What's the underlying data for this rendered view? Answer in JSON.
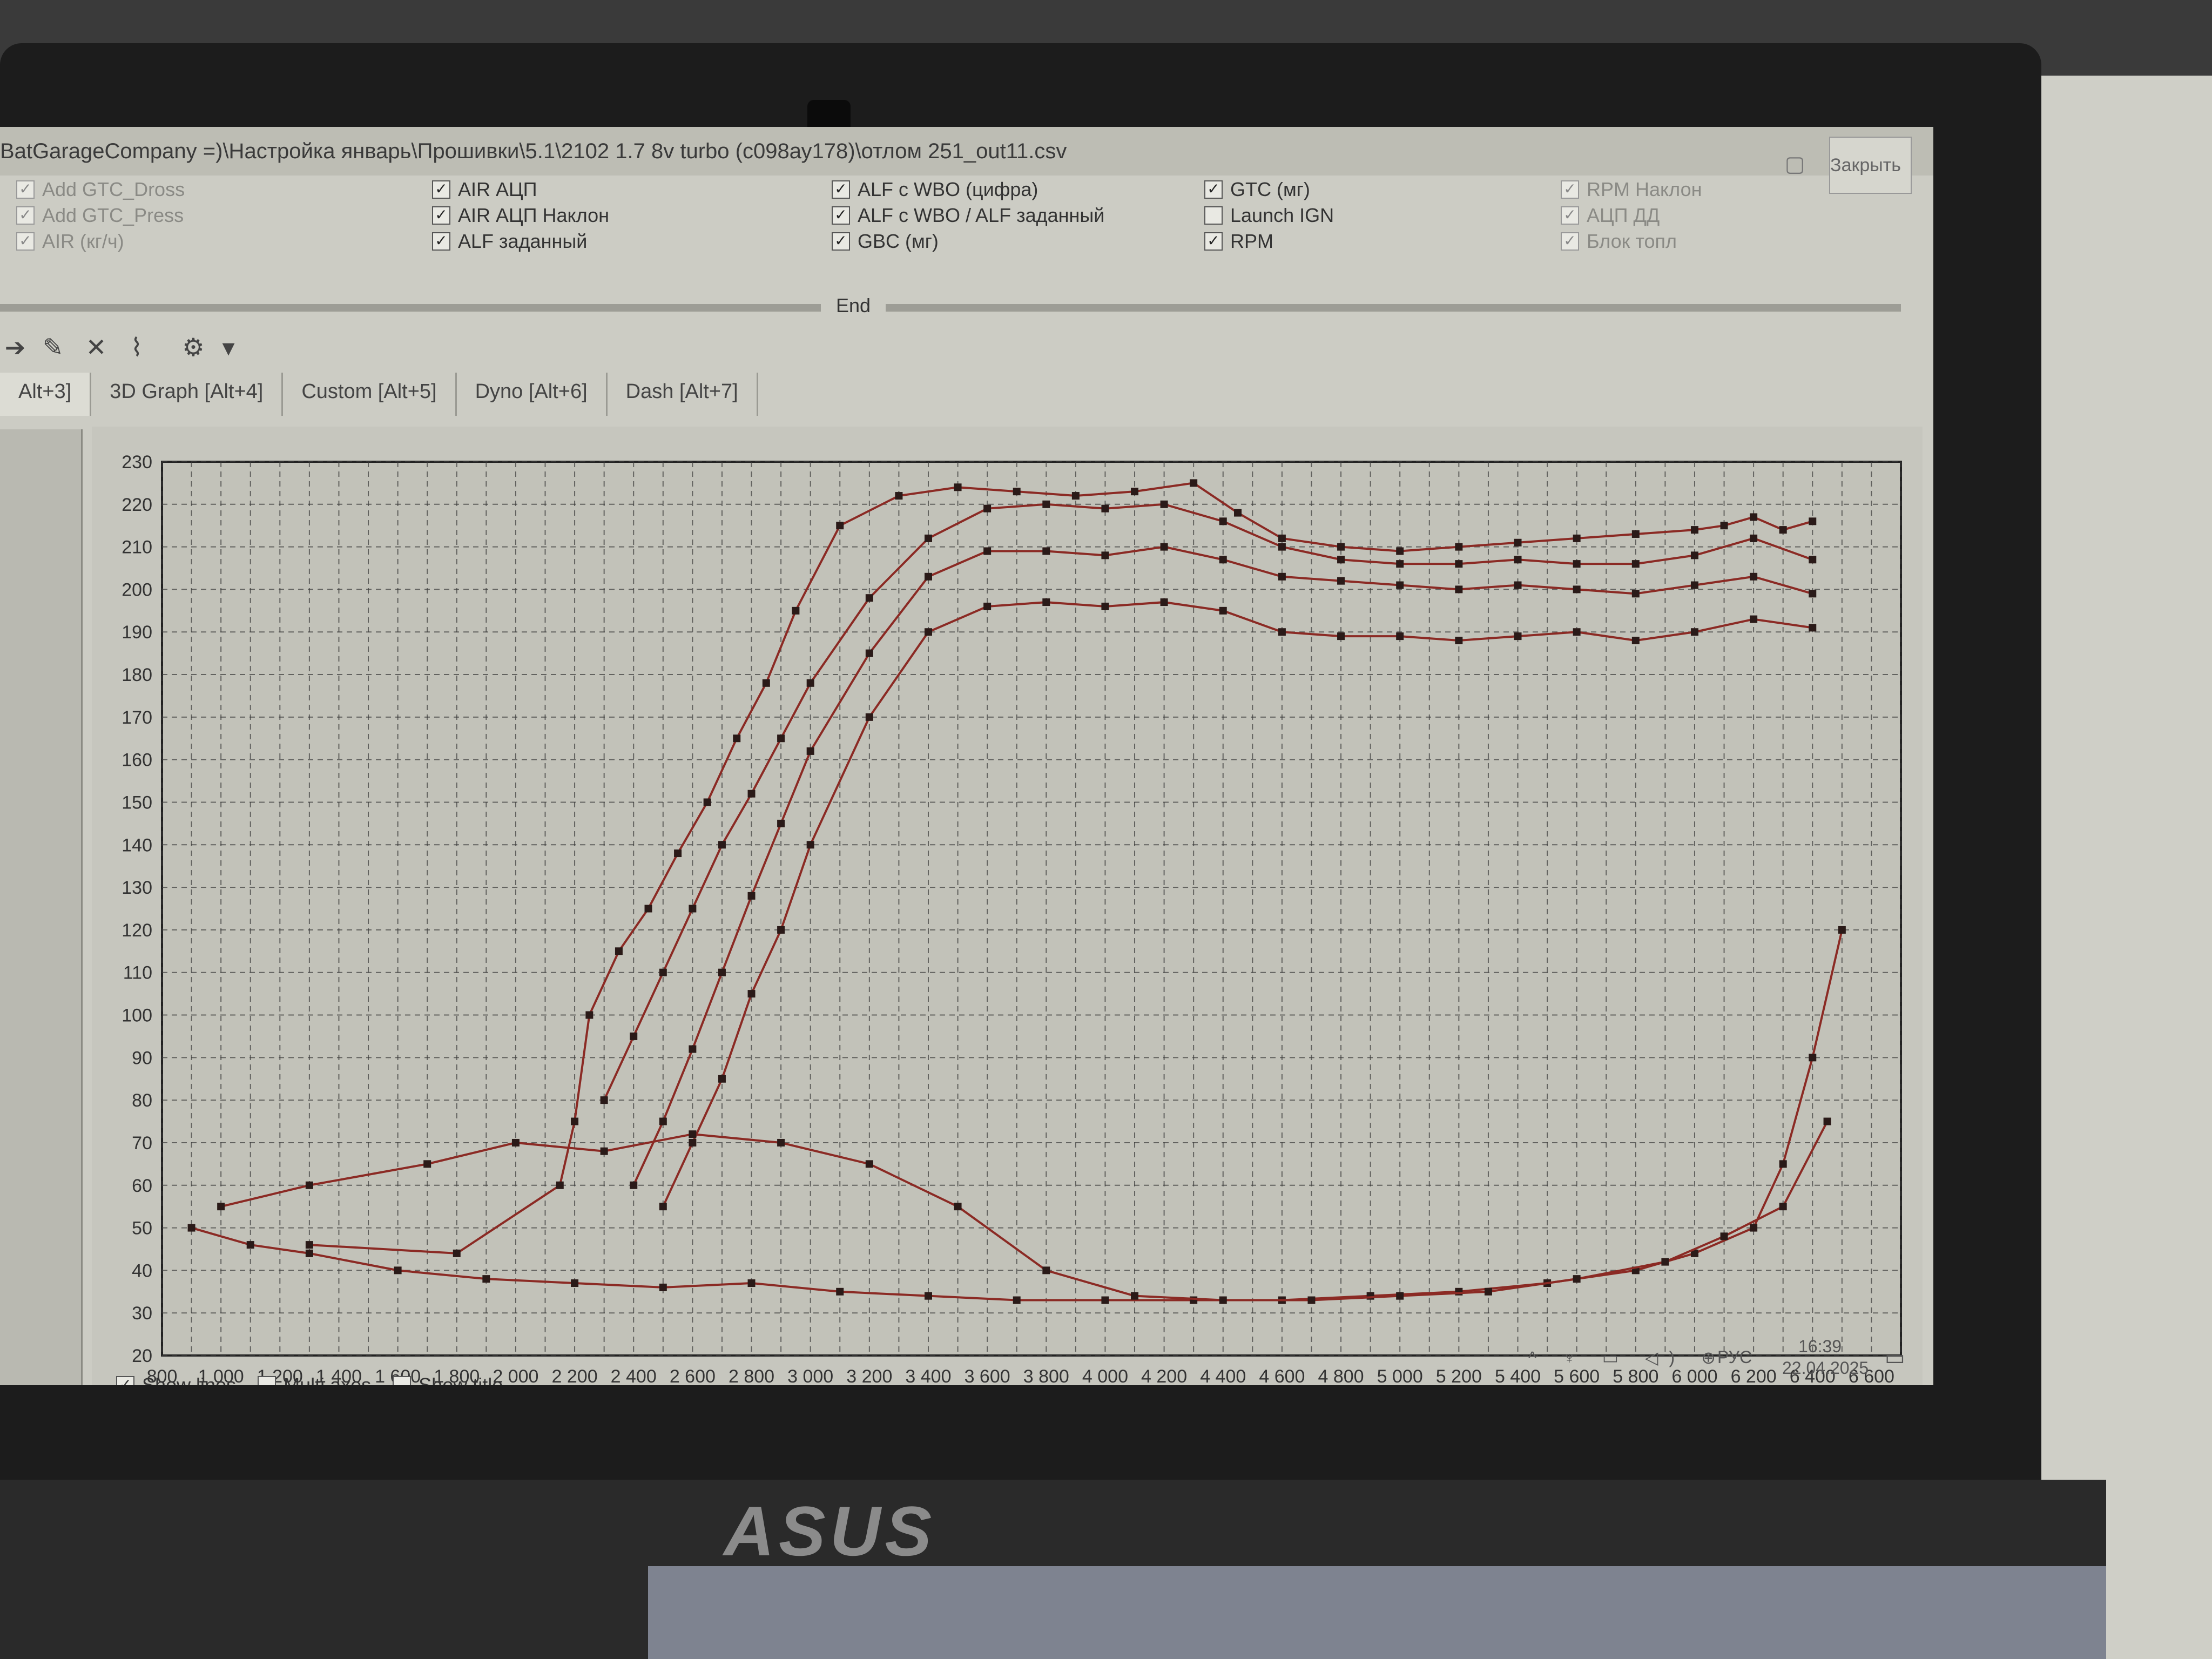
{
  "window": {
    "title": "BatGarageCompany =)\\Настройка январь\\Прошивки\\5.1\\2102 1.7 8v turbo (с098ау178)\\отлом 251_out11.csv",
    "close_label": "Закрыть"
  },
  "checkboxes": [
    {
      "label": "Add GTC_Dross",
      "checked": true,
      "faded": true
    },
    {
      "label": "Add GTC_Press",
      "checked": true,
      "faded": true
    },
    {
      "label": "AIR (кг/ч)",
      "checked": true,
      "faded": true
    },
    {
      "label": "AIR АЦП",
      "checked": true,
      "faded": false
    },
    {
      "label": "AIR АЦП Наклон",
      "checked": true,
      "faded": false
    },
    {
      "label": "ALF заданный",
      "checked": true,
      "faded": false
    },
    {
      "label": "ALF с WBO (цифра)",
      "checked": true,
      "faded": false
    },
    {
      "label": "ALF с WBO / ALF заданный",
      "checked": true,
      "faded": false
    },
    {
      "label": "GBC (мг)",
      "checked": true,
      "faded": false
    },
    {
      "label": "GTC (мг)",
      "checked": true,
      "faded": false
    },
    {
      "label": "Launch IGN",
      "checked": false,
      "faded": false
    },
    {
      "label": "RPM",
      "checked": true,
      "faded": false
    },
    {
      "label": "RPM Наклон",
      "checked": true,
      "faded": true
    },
    {
      "label": "АЦП ДД",
      "checked": true,
      "faded": true
    },
    {
      "label": "Блок топл",
      "checked": true,
      "faded": true
    }
  ],
  "range": {
    "end_label": "End"
  },
  "toolbar": {
    "icons": [
      "arrow-icon",
      "edit-chart-icon",
      "clear-icon",
      "chart-icon",
      "settings-icon",
      "dropdown-icon"
    ]
  },
  "tabs": [
    "Alt+3]",
    "3D Graph [Alt+4]",
    "Custom [Alt+5]",
    "Dyno [Alt+6]",
    "Dash [Alt+7]"
  ],
  "options": [
    {
      "label": "Show lines",
      "checked": true
    },
    {
      "label": "Multi axes",
      "checked": false
    },
    {
      "label": "Show title",
      "checked": false
    }
  ],
  "tray": {
    "icons": "^ ♆ ▭ ◁) ⊕",
    "lang": "РУС",
    "time": "16:39",
    "date": "22.04.2025",
    "notify_icon": "notification-icon"
  },
  "laptop": {
    "brand": "ASUS"
  },
  "colors": {
    "line": "#8b2a24",
    "marker": "#2a1a18",
    "grid": "#3a3a3a",
    "plot_bg": "#c2c2b9"
  },
  "chart_data": {
    "type": "scatter",
    "title": "",
    "xlabel": "",
    "ylabel": "",
    "xlim": [
      800,
      6700
    ],
    "ylim": [
      20,
      230
    ],
    "x_ticks": [
      "800",
      "1 000",
      "1 200",
      "1 400",
      "1 600",
      "1 800",
      "2 000",
      "2 200",
      "2 400",
      "2 600",
      "2 800",
      "3 000",
      "3 200",
      "3 400",
      "3 600",
      "3 800",
      "4 000",
      "4 200",
      "4 400",
      "4 600",
      "4 800",
      "5 000",
      "5 200",
      "5 400",
      "5 600",
      "5 800",
      "6 000",
      "6 200",
      "6 400",
      "6 600"
    ],
    "y_ticks": [
      "20",
      "30",
      "40",
      "50",
      "60",
      "70",
      "80",
      "90",
      "100",
      "110",
      "120",
      "130",
      "140",
      "150",
      "160",
      "170",
      "180",
      "190",
      "200",
      "210",
      "220",
      "230"
    ],
    "series": [
      {
        "x": [
          1300,
          1800,
          2150,
          2200,
          2250,
          2350,
          2450,
          2550,
          2650,
          2750,
          2850,
          2950,
          3100,
          3300,
          3500,
          3700,
          3900,
          4100,
          4300,
          4450,
          4600,
          4800,
          5000,
          5200,
          5400,
          5600,
          5800,
          6000,
          6100,
          6200,
          6300,
          6400
        ],
        "y": [
          46,
          44,
          60,
          75,
          100,
          115,
          125,
          138,
          150,
          165,
          178,
          195,
          215,
          222,
          224,
          223,
          222,
          223,
          225,
          218,
          212,
          210,
          209,
          210,
          211,
          212,
          213,
          214,
          215,
          217,
          214,
          216
        ]
      },
      {
        "x": [
          2300,
          2400,
          2500,
          2600,
          2700,
          2800,
          2900,
          3000,
          3200,
          3400,
          3600,
          3800,
          4000,
          4200,
          4400,
          4600,
          4800,
          5000,
          5200,
          5400,
          5600,
          5800,
          6000,
          6200,
          6400
        ],
        "y": [
          80,
          95,
          110,
          125,
          140,
          152,
          165,
          178,
          198,
          212,
          219,
          220,
          219,
          220,
          216,
          210,
          207,
          206,
          206,
          207,
          206,
          206,
          208,
          212,
          207
        ]
      },
      {
        "x": [
          2400,
          2500,
          2600,
          2700,
          2800,
          2900,
          3000,
          3200,
          3400,
          3600,
          3800,
          4000,
          4200,
          4400,
          4600,
          4800,
          5000,
          5200,
          5400,
          5600,
          5800,
          6000,
          6200,
          6400
        ],
        "y": [
          60,
          75,
          92,
          110,
          128,
          145,
          162,
          185,
          203,
          209,
          209,
          208,
          210,
          207,
          203,
          202,
          201,
          200,
          201,
          200,
          199,
          201,
          203,
          199
        ]
      },
      {
        "x": [
          2500,
          2600,
          2700,
          2800,
          2900,
          3000,
          3200,
          3400,
          3600,
          3800,
          4000,
          4200,
          4400,
          4600,
          4800,
          5000,
          5200,
          5400,
          5600,
          5800,
          6000,
          6200,
          6400
        ],
        "y": [
          55,
          70,
          85,
          105,
          120,
          140,
          170,
          190,
          196,
          197,
          196,
          197,
          195,
          190,
          189,
          189,
          188,
          189,
          190,
          188,
          190,
          193,
          191
        ]
      },
      {
        "x": [
          900,
          1100,
          1300,
          1600,
          1900,
          2200,
          2500,
          2800,
          3100,
          3400,
          3700,
          4000,
          4300,
          4600,
          4900,
          5200,
          5500,
          5800,
          6000,
          6200,
          6300,
          6400,
          6500
        ],
        "y": [
          50,
          46,
          44,
          40,
          38,
          37,
          36,
          37,
          35,
          34,
          33,
          33,
          33,
          33,
          34,
          35,
          37,
          40,
          44,
          50,
          65,
          90,
          120
        ]
      },
      {
        "x": [
          1000,
          1300,
          1700,
          2000,
          2300,
          2600,
          2900,
          3200,
          3500,
          3800,
          4100,
          4400,
          4700,
          5000,
          5300,
          5600,
          5900,
          6100,
          6300,
          6450
        ],
        "y": [
          55,
          60,
          65,
          70,
          68,
          72,
          70,
          65,
          55,
          40,
          34,
          33,
          33,
          34,
          35,
          38,
          42,
          48,
          55,
          75
        ]
      }
    ]
  }
}
